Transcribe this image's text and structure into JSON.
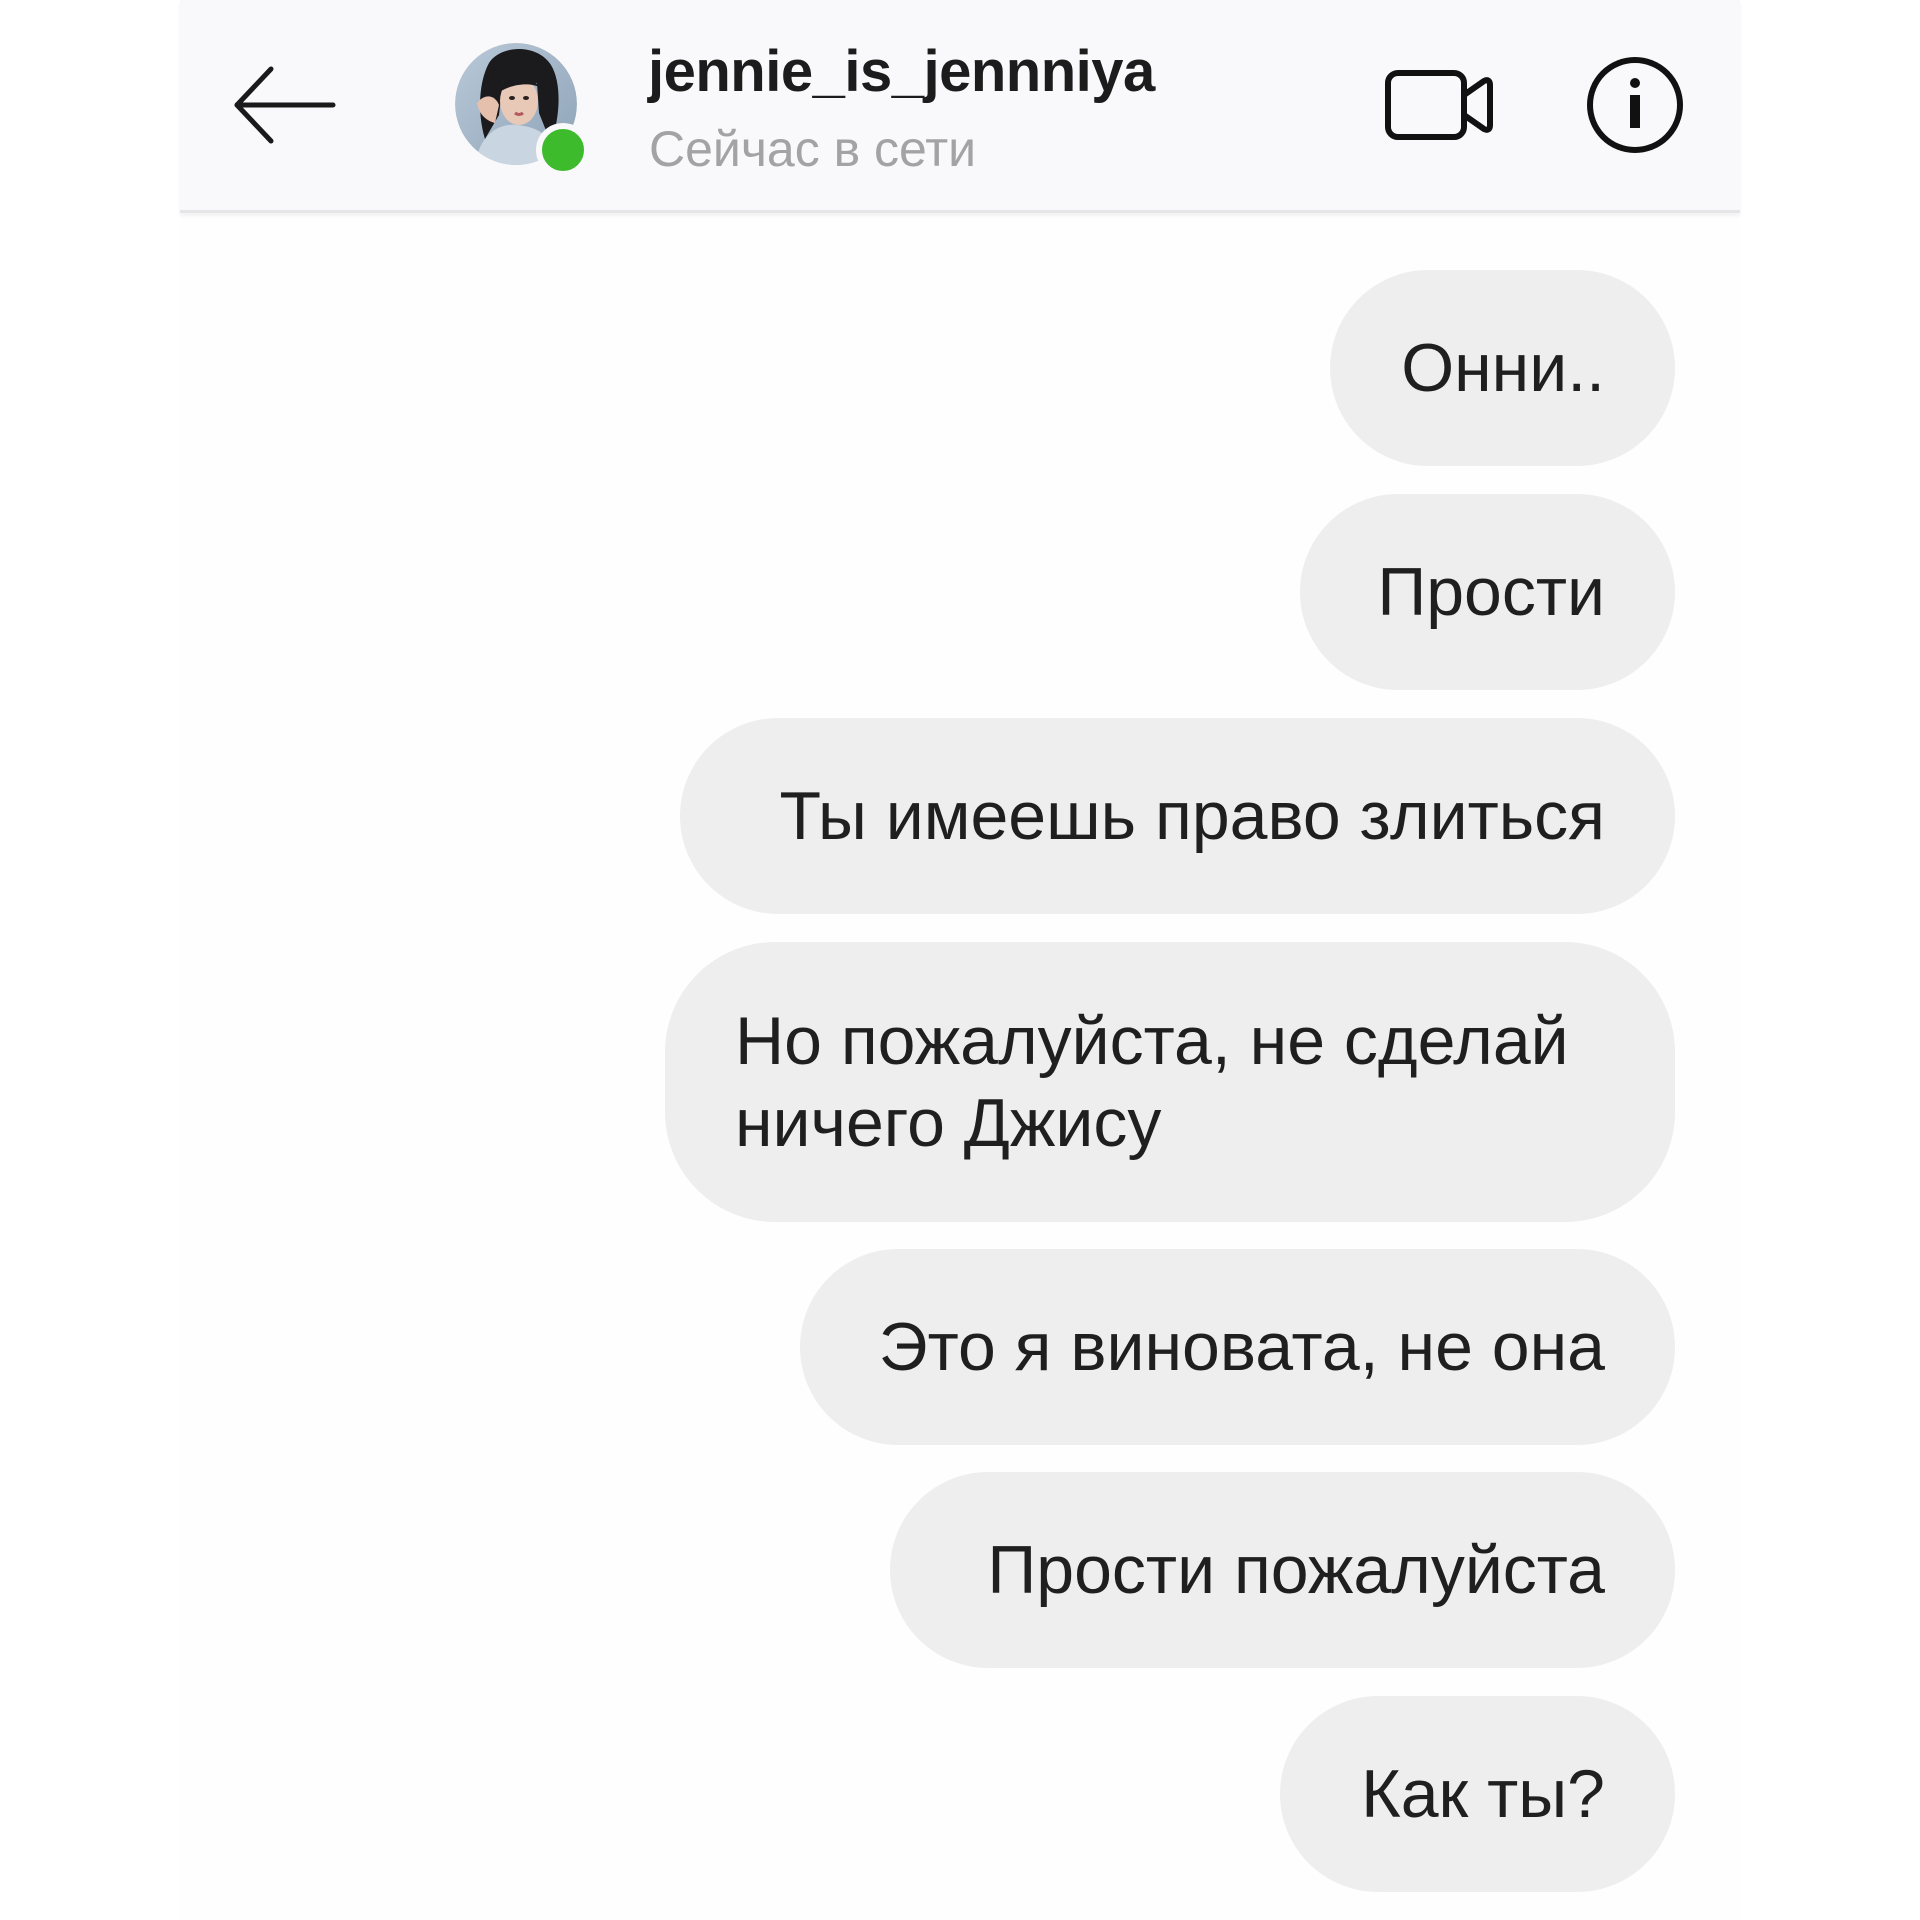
{
  "header": {
    "username": "jennie_is_jennniya",
    "status": "Сейчас в сети",
    "online_color": "#3dbb2c",
    "back_icon": "arrow-left-icon",
    "video_icon": "video-camera-icon",
    "info_icon": "info-icon"
  },
  "messages": [
    {
      "text": "Онни.."
    },
    {
      "text": "Прости"
    },
    {
      "text": "Ты имеешь право злиться"
    },
    {
      "text": "Но пожалуйста, не сделай ничего Джису"
    },
    {
      "text": "Это я виновата, не она"
    },
    {
      "text": "Прости пожалуйста"
    },
    {
      "text": "Как ты?"
    }
  ],
  "colors": {
    "bubble_bg": "#efeeef",
    "header_bg": "#f9f8fa",
    "text": "#1f1f1f"
  }
}
